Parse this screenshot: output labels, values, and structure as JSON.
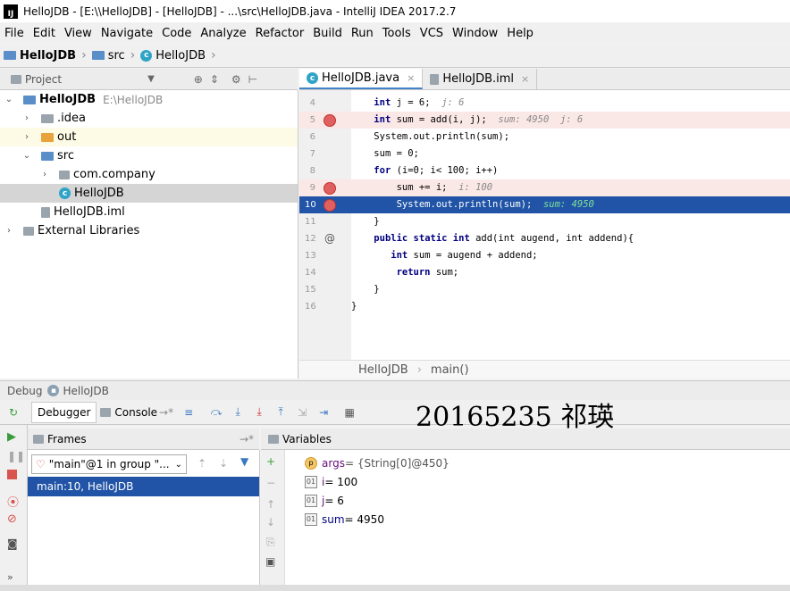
{
  "window": {
    "title": "HelloJDB - [E:\\\\HelloJDB] - [HelloJDB] - ...\\src\\HelloJDB.java - IntelliJ IDEA 2017.2.7",
    "logo": "IJ"
  },
  "menu": [
    "File",
    "Edit",
    "View",
    "Navigate",
    "Code",
    "Analyze",
    "Refactor",
    "Build",
    "Run",
    "Tools",
    "VCS",
    "Window",
    "Help"
  ],
  "breadcrumb": {
    "project": "HelloJDB",
    "folder": "src",
    "file": "HelloJDB"
  },
  "project_panel": {
    "title": "Project",
    "tree": [
      {
        "label": "HelloJDB",
        "extra": "E:\\HelloJDB",
        "arrow": "⌄"
      },
      {
        "label": ".idea",
        "arrow": "›"
      },
      {
        "label": "out",
        "arrow": "›"
      },
      {
        "label": "src",
        "arrow": "⌄"
      },
      {
        "label": "com.company",
        "arrow": "›"
      },
      {
        "label": "HelloJDB",
        "arrow": ""
      },
      {
        "label": "HelloJDB.iml",
        "arrow": ""
      },
      {
        "label": "External Libraries",
        "arrow": "›"
      }
    ]
  },
  "editor": {
    "tabs": [
      {
        "label": "HelloJDB.java",
        "close": "×"
      },
      {
        "label": "HelloJDB.iml",
        "close": "×"
      }
    ],
    "line_numbers": [
      "4",
      "5",
      "6",
      "7",
      "8",
      "9",
      "10",
      "11",
      "12",
      "13",
      "14",
      "15",
      "16"
    ],
    "code_lines": [
      {
        "pre": "    ",
        "kw": "int",
        "text": " j = 6;",
        "inline": "  j: 6"
      },
      {
        "pre": "    ",
        "kw": "int",
        "text": " sum = add(i, j);",
        "inline": "  sum: 4950  j: 6"
      },
      {
        "pre": "    ",
        "kw": "",
        "text": "System.out.println(sum);",
        "inline": ""
      },
      {
        "pre": "    ",
        "kw": "",
        "text": "sum = 0;",
        "inline": ""
      },
      {
        "pre": "    ",
        "kw": "for",
        "text": " (i=0; i< 100; i++)",
        "inline": ""
      },
      {
        "pre": "        ",
        "kw": "",
        "text": "sum += i;",
        "inline": "  i: 100"
      },
      {
        "pre": "        ",
        "kw": "",
        "text": "System.out.println(sum);",
        "inline": "  sum: 4950"
      },
      {
        "pre": "    ",
        "kw": "",
        "text": "}",
        "inline": ""
      },
      {
        "pre": "    ",
        "kw": "public static int",
        "text": " add(int augend, int addend){",
        "inline": ""
      },
      {
        "pre": "       ",
        "kw": "int",
        "text": " sum = augend + addend;",
        "inline": ""
      },
      {
        "pre": "        ",
        "kw": "return",
        "text": " sum;",
        "inline": ""
      },
      {
        "pre": "    ",
        "kw": "",
        "text": "}",
        "inline": ""
      },
      {
        "pre": "",
        "kw": "",
        "text": "}",
        "inline": ""
      }
    ],
    "crumbs": [
      "HelloJDB",
      "main()"
    ]
  },
  "debug": {
    "title": "Debug",
    "config": "HelloJDB",
    "tabs": {
      "debugger": "Debugger",
      "console": "Console"
    },
    "watermark": "20165235 祁瑛",
    "frames_title": "Frames",
    "thread": "\"main\"@1 in group \"...",
    "frame": "main:10, HelloJDB",
    "variables_title": "Variables",
    "variables": [
      {
        "name": "args",
        "value": " = {String[0]@450}",
        "icon": "p"
      },
      {
        "name": "i",
        "value": " = 100",
        "icon": "01"
      },
      {
        "name": "j",
        "value": " = 6",
        "icon": "01"
      },
      {
        "name": "sum",
        "value": " = 4950",
        "icon": "01"
      }
    ]
  },
  "colors": {
    "selection": "#2154a6",
    "breakpoint_line": "#fae8e6",
    "keyword": "#000080"
  }
}
